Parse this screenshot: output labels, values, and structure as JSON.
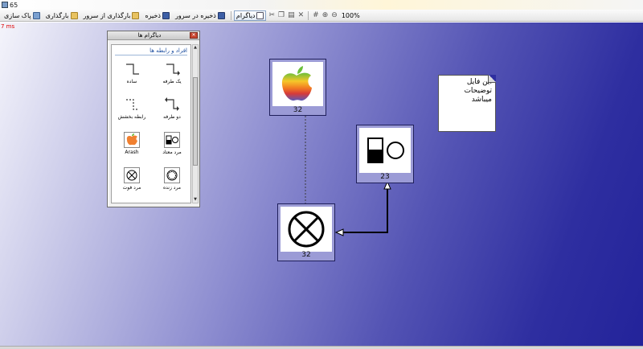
{
  "window": {
    "title": "65"
  },
  "toolbar": {
    "clean_label": "پاک سازی",
    "load_label": "بارگذاری",
    "load_server_label": "بارگذاری از سرور",
    "save_label": "ذخیره",
    "save_server_label": "ذخیره در سرور",
    "diagram_label": "دیاگرام",
    "zoom_level": "100%"
  },
  "canvas": {
    "timing": "7 ms"
  },
  "palette": {
    "title": "دیاگرام ها",
    "group_title": "افراد و رابطه ها",
    "items": [
      {
        "label": "یک طرفه",
        "icon": "one-way-connector-icon"
      },
      {
        "label": "ساده",
        "icon": "simple-connector-icon"
      },
      {
        "label": "دو طرفه",
        "icon": "two-way-connector-icon"
      },
      {
        "label": "رابطه بخشش",
        "icon": "dashed-relation-icon"
      },
      {
        "label": "مرد معتاد",
        "icon": "addicted-man-icon"
      },
      {
        "label": "Arash",
        "icon": "apple-icon"
      },
      {
        "label": "مرد زنده",
        "icon": "living-man-icon"
      },
      {
        "label": "مرد فوت",
        "icon": "deceased-man-icon"
      }
    ]
  },
  "diagram": {
    "nodes": [
      {
        "id": "apple-node",
        "label": "32",
        "icon": "apple-icon"
      },
      {
        "id": "addicted-node",
        "label": "23",
        "icon": "addicted-man-icon"
      },
      {
        "id": "deceased-node",
        "label": "32",
        "icon": "deceased-man-icon"
      }
    ],
    "note_text": "این فایل توضیحات میباشد"
  },
  "colors": {
    "canvas_dark": "#23239a",
    "canvas_light": "#f4f4fb",
    "node_frame": "#9b9bd6",
    "timing_red": "#dd0000"
  }
}
